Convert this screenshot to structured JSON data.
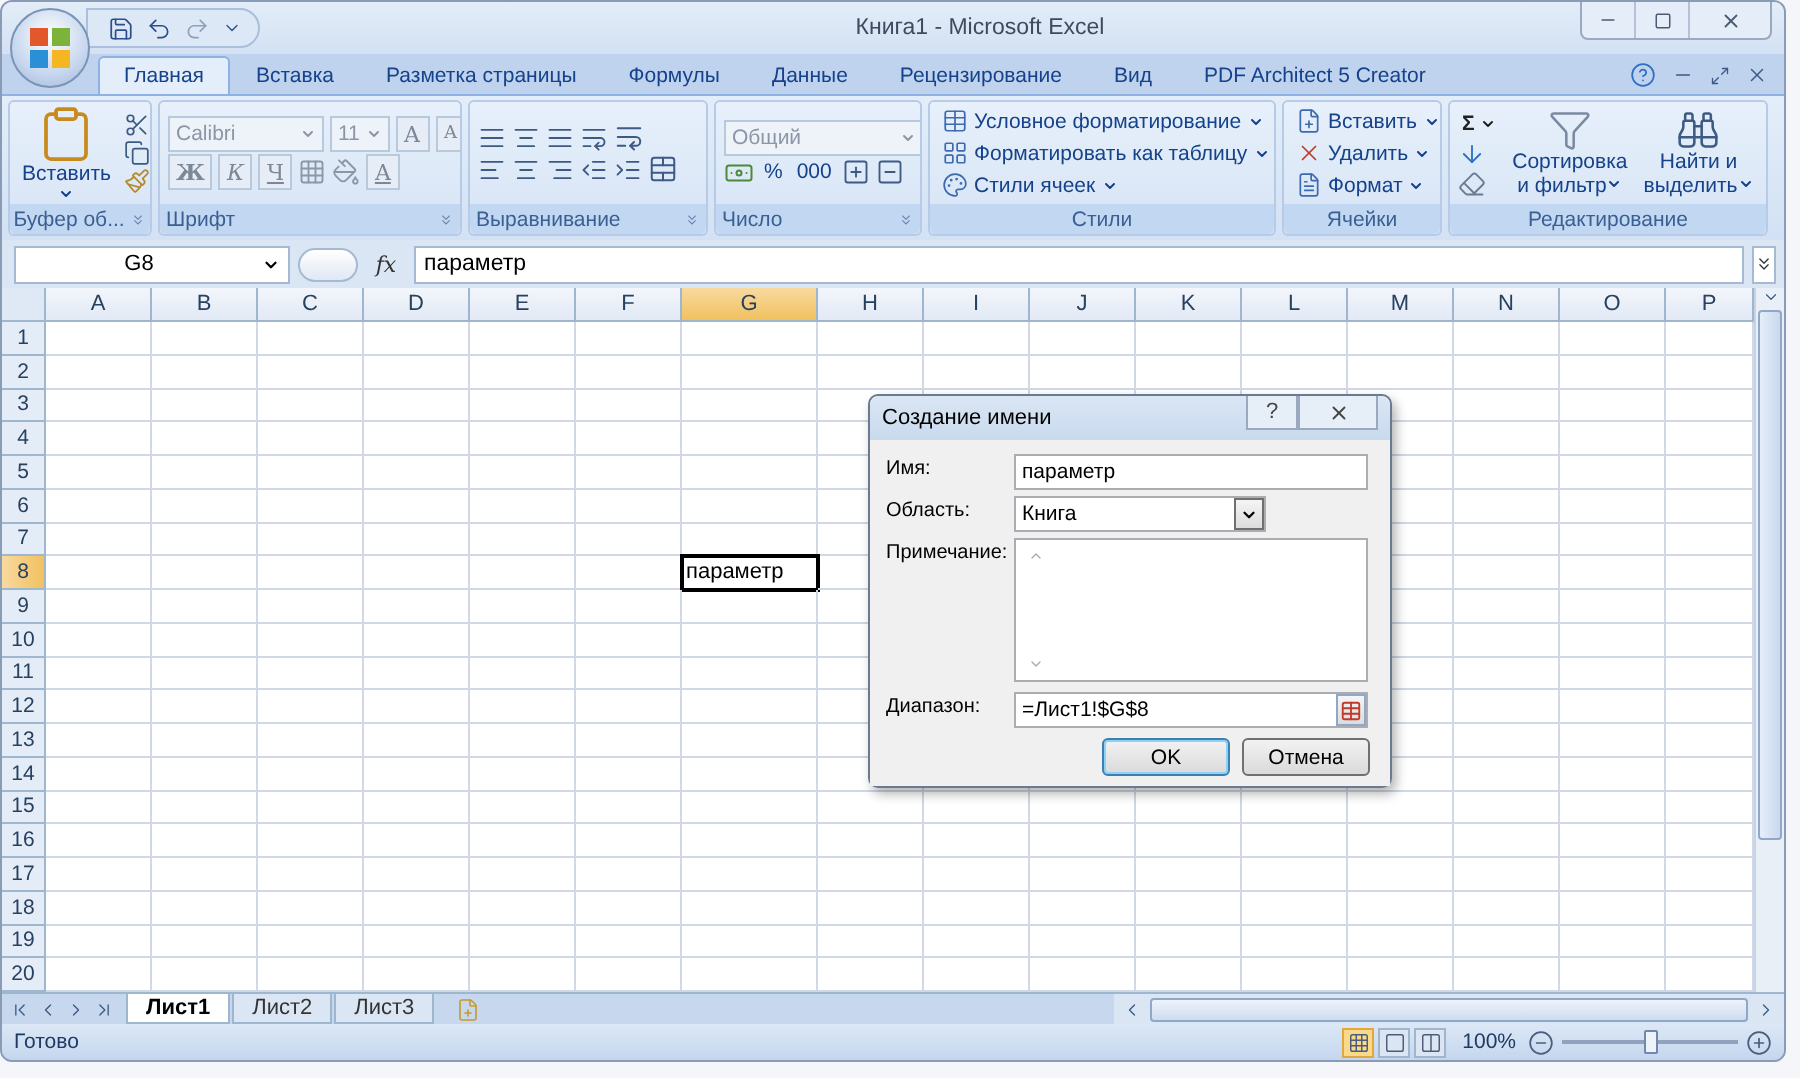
{
  "window": {
    "title": "Книга1 - Microsoft Excel"
  },
  "tabs": [
    {
      "label": "Главная",
      "selected": true
    },
    {
      "label": "Вставка",
      "selected": false
    },
    {
      "label": "Разметка страницы",
      "selected": false
    },
    {
      "label": "Формулы",
      "selected": false
    },
    {
      "label": "Данные",
      "selected": false
    },
    {
      "label": "Рецензирование",
      "selected": false
    },
    {
      "label": "Вид",
      "selected": false
    },
    {
      "label": "PDF Architect 5 Creator",
      "selected": false
    }
  ],
  "ribbon": {
    "groups": [
      {
        "kind": "clipboard",
        "label": "Буфер об...",
        "paste": "Вставить"
      },
      {
        "kind": "font",
        "label": "Шрифт",
        "font": "Calibri",
        "size": "11",
        "grow": "A",
        "shrink": "A",
        "bold": "Ж",
        "italic": "К",
        "underline": "Ч",
        "font_color": "A"
      },
      {
        "kind": "alignment",
        "label": "Выравнивание"
      },
      {
        "kind": "number",
        "label": "Число",
        "format": "Общий",
        "percent": "%",
        "thousands": "000"
      },
      {
        "kind": "styles",
        "label": "Стили",
        "items": [
          "Условное форматирование",
          "Форматировать как таблицу",
          "Стили ячеек"
        ]
      },
      {
        "kind": "cells",
        "label": "Ячейки",
        "items": [
          "Вставить",
          "Удалить",
          "Формат"
        ]
      },
      {
        "kind": "editing",
        "label": "Редактирование",
        "sum": "Σ",
        "sort": "Сортировка и фильтр",
        "find": "Найти и выделить"
      }
    ]
  },
  "formula_bar": {
    "name_box": "G8",
    "function_label": "fx",
    "value": "параметр"
  },
  "sheet": {
    "columns": [
      {
        "label": "A",
        "selected": false
      },
      {
        "label": "B",
        "selected": false
      },
      {
        "label": "C",
        "selected": false
      },
      {
        "label": "D",
        "selected": false
      },
      {
        "label": "E",
        "selected": false
      },
      {
        "label": "F",
        "selected": false
      },
      {
        "label": "G",
        "selected": true
      },
      {
        "label": "H",
        "selected": false
      },
      {
        "label": "I",
        "selected": false
      },
      {
        "label": "J",
        "selected": false
      },
      {
        "label": "K",
        "selected": false
      },
      {
        "label": "L",
        "selected": false
      },
      {
        "label": "M",
        "selected": false
      },
      {
        "label": "N",
        "selected": false
      },
      {
        "label": "O",
        "selected": false
      },
      {
        "label": "P",
        "selected": false
      }
    ],
    "rows": [
      {
        "label": "1",
        "selected": false
      },
      {
        "label": "2",
        "selected": false
      },
      {
        "label": "3",
        "selected": false
      },
      {
        "label": "4",
        "selected": false
      },
      {
        "label": "5",
        "selected": false
      },
      {
        "label": "6",
        "selected": false
      },
      {
        "label": "7",
        "selected": false
      },
      {
        "label": "8",
        "selected": true,
        "cells": [
          null,
          null,
          null,
          null,
          null,
          null,
          "параметр"
        ]
      },
      {
        "label": "9",
        "selected": false
      },
      {
        "label": "10",
        "selected": false
      },
      {
        "label": "11",
        "selected": false
      },
      {
        "label": "12",
        "selected": false
      },
      {
        "label": "13",
        "selected": false
      },
      {
        "label": "14",
        "selected": false
      },
      {
        "label": "15",
        "selected": false
      },
      {
        "label": "16",
        "selected": false
      },
      {
        "label": "17",
        "selected": false
      },
      {
        "label": "18",
        "selected": false
      },
      {
        "label": "19",
        "selected": false
      },
      {
        "label": "20",
        "selected": false
      }
    ]
  },
  "dialog": {
    "title": "Создание имени",
    "help": "?",
    "fields": [
      {
        "kind": "text",
        "label": "Имя:",
        "value": "параметр"
      },
      {
        "kind": "select",
        "label": "Область:",
        "value": "Книга"
      },
      {
        "kind": "textarea",
        "label": "Примечание:"
      },
      {
        "kind": "range",
        "label": "Диапазон:",
        "value": "=Лист1!$G$8"
      }
    ],
    "buttons": [
      {
        "label": "OK",
        "default": true
      },
      {
        "label": "Отмена",
        "default": false
      }
    ]
  },
  "sheet_tabs": [
    {
      "label": "Лист1",
      "selected": true
    },
    {
      "label": "Лист2",
      "selected": false
    },
    {
      "label": "Лист3",
      "selected": false
    }
  ],
  "status_bar": {
    "status": "Готово",
    "views": [
      {
        "kind": "normal",
        "selected": true
      },
      {
        "kind": "page_layout",
        "selected": false
      },
      {
        "kind": "page_break",
        "selected": false
      }
    ],
    "zoom": "100%",
    "zoom_level": {
      "level": 0.5
    }
  }
}
